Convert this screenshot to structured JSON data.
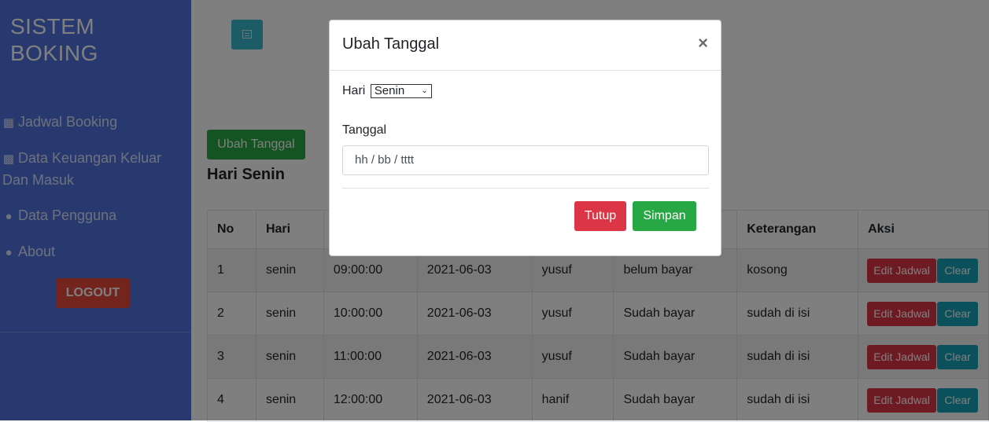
{
  "sidebar": {
    "brand_line1": "SISTEM",
    "brand_line2": "BOKING",
    "items": [
      {
        "label": "Jadwal Booking",
        "icon": "calendar-icon"
      },
      {
        "label": "Data Keuangan Keluar Dan Masuk",
        "icon": "wallet-icon"
      },
      {
        "label": "Data Pengguna",
        "icon": "users-icon"
      },
      {
        "label": "About",
        "icon": "lightbulb-icon"
      }
    ],
    "logout_label": "LOGOUT"
  },
  "main": {
    "ubah_button": "Ubah Tanggal",
    "day_title": "Hari Senin",
    "table": {
      "headers": [
        "No",
        "Hari",
        "",
        "",
        "",
        "",
        "Keterangan",
        "Aksi"
      ],
      "rows": [
        [
          "1",
          "senin",
          "09:00:00",
          "2021-06-03",
          "yusuf",
          "belum bayar",
          "kosong"
        ],
        [
          "2",
          "senin",
          "10:00:00",
          "2021-06-03",
          "yusuf",
          "Sudah bayar",
          "sudah di isi"
        ],
        [
          "3",
          "senin",
          "11:00:00",
          "2021-06-03",
          "yusuf",
          "Sudah bayar",
          "sudah di isi"
        ],
        [
          "4",
          "senin",
          "12:00:00",
          "2021-06-03",
          "hanif",
          "Sudah bayar",
          "sudah di isi"
        ]
      ],
      "edit_label": "Edit Jadwal",
      "clear_label": "Clear"
    }
  },
  "modal": {
    "title": "Ubah Tanggal",
    "close": "×",
    "hari_label": "Hari",
    "hari_value": "Senin",
    "tanggal_label": "Tanggal",
    "tanggal_placeholder": "hh / bb / tttt",
    "tutup_label": "Tutup",
    "simpan_label": "Simpan"
  },
  "colors": {
    "sidebar": "#4e73df",
    "success": "#28a745",
    "danger": "#dc3545",
    "info": "#17a2b8"
  }
}
